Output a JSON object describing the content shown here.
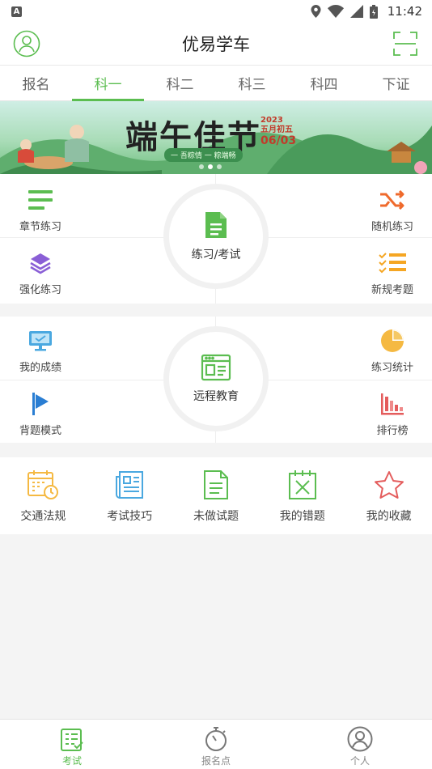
{
  "status_bar": {
    "badge": "A",
    "time": "11:42"
  },
  "header": {
    "title": "优易学车"
  },
  "tabs": [
    {
      "label": "报名"
    },
    {
      "label": "科一",
      "active": true
    },
    {
      "label": "科二"
    },
    {
      "label": "科三"
    },
    {
      "label": "科四"
    },
    {
      "label": "下证"
    }
  ],
  "banner": {
    "title": "端午佳节",
    "subtitle": "一 吾粽情 一 粽端畅",
    "date_top": "2023",
    "date_mid": "五月初五",
    "date_big": "06/03"
  },
  "practice_panel": {
    "center_label": "练习/考试",
    "items": [
      {
        "label": "章节练习"
      },
      {
        "label": "随机练习"
      },
      {
        "label": "强化练习"
      },
      {
        "label": "新规考题"
      }
    ]
  },
  "remote_panel": {
    "center_label": "远程教育",
    "items": [
      {
        "label": "我的成绩"
      },
      {
        "label": "练习统计"
      },
      {
        "label": "背题模式"
      },
      {
        "label": "排行榜"
      }
    ]
  },
  "quick_links": [
    {
      "label": "交通法规"
    },
    {
      "label": "考试技巧"
    },
    {
      "label": "未做试题"
    },
    {
      "label": "我的错题"
    },
    {
      "label": "我的收藏"
    }
  ],
  "bottom_nav": [
    {
      "label": "考试",
      "active": true
    },
    {
      "label": "报名点"
    },
    {
      "label": "个人"
    }
  ],
  "colors": {
    "accent": "#5bbd50",
    "orange": "#ef6a2c",
    "purple": "#8a5fd6",
    "blue": "#4aa8e0",
    "yellow": "#f5b942",
    "red": "#e45c5c"
  }
}
